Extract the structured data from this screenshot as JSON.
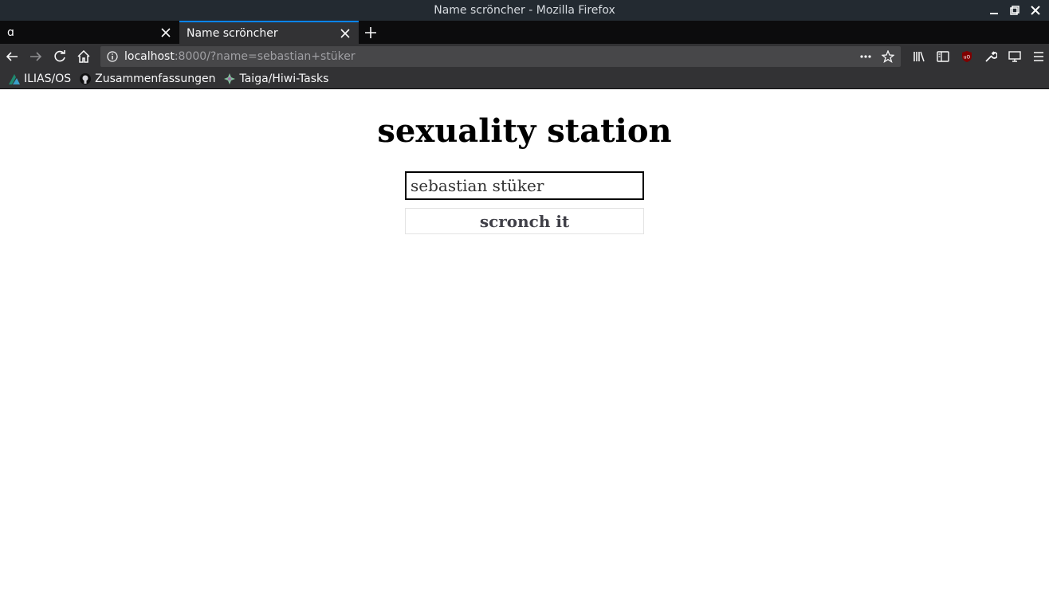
{
  "window": {
    "title": "Name scröncher - Mozilla Firefox"
  },
  "tabs": [
    {
      "label": "ɑ",
      "active": false
    },
    {
      "label": "Name scröncher",
      "active": true
    }
  ],
  "navbar": {
    "url_host": "localhost",
    "url_rest": ":8000/?name=sebastian+stüker"
  },
  "bookmarks": [
    {
      "label": "ILIAS/OS",
      "icon": "ilias-icon"
    },
    {
      "label": "Zusammenfassungen",
      "icon": "github-icon"
    },
    {
      "label": "Taiga/Hiwi-Tasks",
      "icon": "taiga-icon"
    }
  ],
  "page": {
    "title": "sexuality station",
    "input_value": "sebastian stüker",
    "button_label": "scronch it"
  },
  "colors": {
    "titlebar": "#232a31",
    "tabstrip": "#0c0c0d",
    "toolbar": "#323234",
    "urlbar": "#474749",
    "accent": "#0a84ff"
  }
}
